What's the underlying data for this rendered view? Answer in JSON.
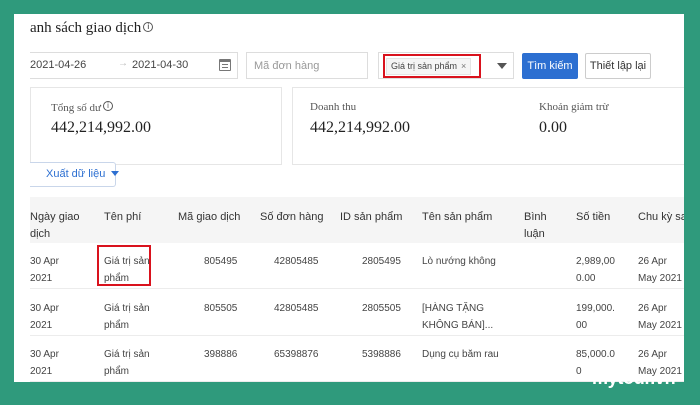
{
  "page": {
    "title": "anh sách giao dịch",
    "info_glyph": "i"
  },
  "filters": {
    "date_from": "2021-04-26",
    "date_sep": "→",
    "date_to": "2021-04-30",
    "order_placeholder": "Mã đơn hàng",
    "selected_tag": "Giá trị sản phẩm",
    "tag_close": "×",
    "search_label": "Tìm kiếm",
    "reset_label": "Thiết lập lại"
  },
  "summary": {
    "balance_label": "Tổng số dư",
    "balance_value": "442,214,992.00",
    "revenue_label": "Doanh thu",
    "revenue_value": "442,214,992.00",
    "deduction_label": "Khoản giảm trừ",
    "deduction_value": "0.00"
  },
  "export_label": "Xuất dữ liệu",
  "table": {
    "headers": {
      "date": [
        "Ngày giao",
        "dịch"
      ],
      "fee": "Tên phí",
      "txn": "Mã giao dịch",
      "order": "Số đơn hàng",
      "product_id": "ID sản phẩm",
      "product_name": "Tên sản phẩm",
      "comment": [
        "Bình",
        "luận"
      ],
      "amount": "Số tiền",
      "cycle": "Chu kỳ sa"
    },
    "rows": [
      {
        "date": [
          "30 Apr",
          "2021"
        ],
        "fee": [
          "Giá trị sản",
          "phẩm"
        ],
        "txn": "805495",
        "order": "42805485",
        "product_id": "2805495",
        "product_name": [
          "Lò nướng không"
        ],
        "amount": [
          "2,989,00",
          "0.00"
        ],
        "cycle": [
          "26 Apr",
          "May 2021"
        ]
      },
      {
        "date": [
          "30 Apr",
          "2021"
        ],
        "fee": [
          "Giá trị sản",
          "phẩm"
        ],
        "txn": "805505",
        "order": "42805485",
        "product_id": "2805505",
        "product_name": [
          "[HÀNG TẶNG",
          "KHÔNG BÁN]..."
        ],
        "amount": [
          "199,000.",
          "00"
        ],
        "cycle": [
          "26 Apr",
          "May 2021"
        ]
      },
      {
        "date": [
          "30 Apr",
          "2021"
        ],
        "fee": [
          "Giá trị sản",
          "phẩm"
        ],
        "txn": "398886",
        "order": "65398876",
        "product_id": "5398886",
        "product_name": [
          "Dụng cụ băm rau"
        ],
        "amount": [
          "85,000.0",
          "0"
        ],
        "cycle": [
          "26 Apr",
          "May 2021"
        ]
      }
    ]
  },
  "watermark": "mytour.vn",
  "colors": {
    "primary": "#2c6fd1",
    "highlight": "#d9121d",
    "frame": "#2f9a7c"
  }
}
